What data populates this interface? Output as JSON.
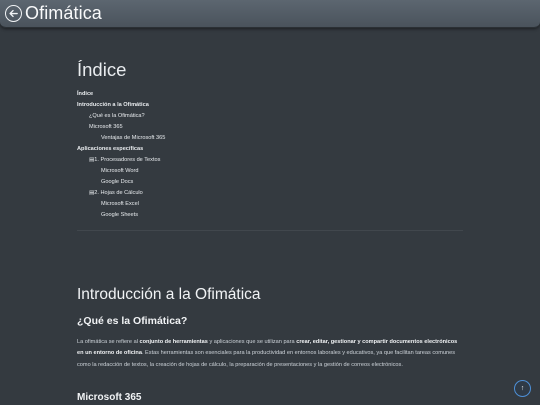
{
  "header": {
    "title": "Ofimática",
    "back_icon": "arrow-left-circle-icon"
  },
  "toc": {
    "title": "Índice",
    "items": [
      {
        "label": "Índice",
        "level": 0
      },
      {
        "label": "Introducción a la Ofimática",
        "level": 0
      },
      {
        "label": "¿Qué es la Ofimática?",
        "level": 1
      },
      {
        "label": "Microsoft 365",
        "level": 1
      },
      {
        "label": "Ventajas de Microsoft 365",
        "level": 2
      },
      {
        "label": "Aplicaciones específicas",
        "level": 0
      },
      {
        "label": "▤1. Procesadores de Textos",
        "level": 1
      },
      {
        "label": "Microsoft Word",
        "level": 2
      },
      {
        "label": "Google Docs",
        "level": 2
      },
      {
        "label": "▤2. Hojas de Cálculo",
        "level": 1
      },
      {
        "label": "Microsoft Excel",
        "level": 2
      },
      {
        "label": "Google Sheets",
        "level": 2
      }
    ]
  },
  "section": {
    "title": "Introducción a la Ofimática",
    "subtitle": "¿Qué es la Ofimática?",
    "para": {
      "t1": "La ofimática se refiere al ",
      "b1": "conjunto de herramientas",
      "t2": " y aplicaciones que se utilizan para ",
      "b2": "crear, editar, gestionar y compartir documentos electrónicos en un entorno de oficina",
      "t3": ". Estas herramientas son esenciales para la productividad en entornos laborales y educativos, ya que facilitan tareas comunes como la redacción de textos, la creación de hojas de cálculo, la preparación de presentaciones y la gestión de correos electrónicos."
    },
    "next_heading": "Microsoft 365"
  },
  "scroll_top": {
    "icon": "arrow-up-icon",
    "glyph": "↑"
  }
}
